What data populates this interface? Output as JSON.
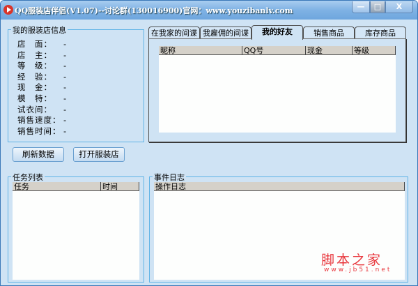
{
  "window": {
    "title": "QQ服装店伴侣(V1.07)--讨论群(130016900)官网：www.youzibanlv.com",
    "min": "—",
    "max": "□",
    "close": "X"
  },
  "shop_info": {
    "legend": "我的服装店信息",
    "rows": [
      {
        "label": "店　面：",
        "value": "-"
      },
      {
        "label": "店　主：",
        "value": "-"
      },
      {
        "label": "等　级：",
        "value": "-"
      },
      {
        "label": "经　验：",
        "value": "-"
      },
      {
        "label": "现　金：",
        "value": "-"
      },
      {
        "label": "模　特：",
        "value": "-"
      },
      {
        "label": "试衣间：",
        "value": "-"
      },
      {
        "label": "销售速度：",
        "value": "-"
      },
      {
        "label": "销售时间：",
        "value": "-"
      }
    ]
  },
  "buttons": {
    "refresh": "刷新数据",
    "open_shop": "打开服装店"
  },
  "tabs": [
    {
      "label": "在我家的间谍"
    },
    {
      "label": "我雇佣的间谍"
    },
    {
      "label": "我的好友",
      "active": true
    },
    {
      "label": "销售商品"
    },
    {
      "label": "库存商品"
    }
  ],
  "friends_table": {
    "columns": [
      "昵称",
      "QQ号",
      "现金",
      "等级"
    ]
  },
  "tasks": {
    "legend": "任务列表",
    "columns": [
      "任务",
      "时间"
    ]
  },
  "log": {
    "legend": "事件日志",
    "columns": [
      "操作日志"
    ]
  },
  "watermark": {
    "text": "脚本之家",
    "url": "www.jb51.net"
  }
}
